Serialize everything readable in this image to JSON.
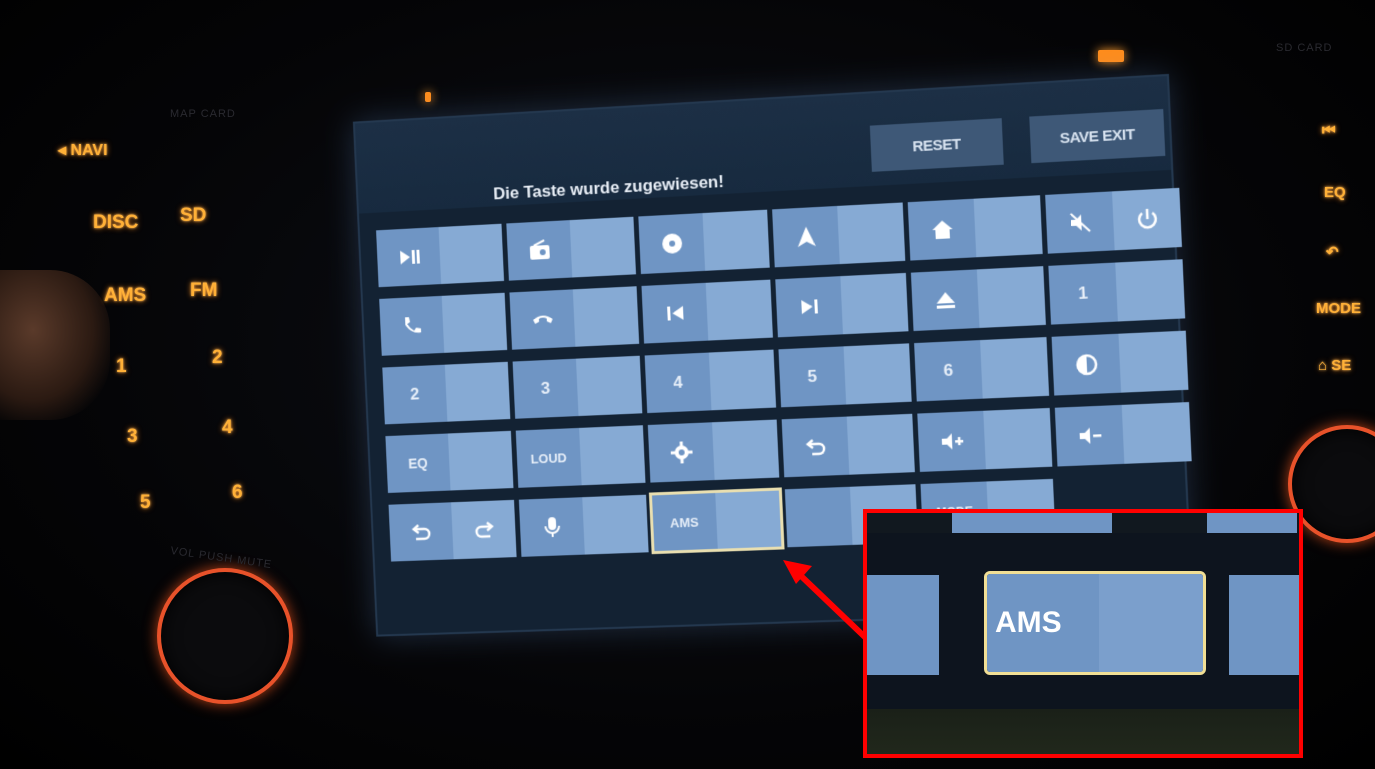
{
  "hardware": {
    "left_buttons": [
      "NAVI",
      "DISC",
      "SD",
      "AMS",
      "FM",
      "1",
      "2",
      "3",
      "4",
      "5",
      "6"
    ],
    "right_buttons": [
      "⏮",
      "EQ",
      "MODE"
    ]
  },
  "screen": {
    "status_message": "Die Taste wurde zugewiesen!",
    "reset_label": "RESET",
    "save_exit_label": "SAVE EXIT",
    "keys": {
      "num1": "1",
      "num2": "2",
      "num3": "3",
      "num4": "4",
      "num5": "5",
      "num6": "6",
      "eq": "EQ",
      "loud": "LOUD",
      "ams": "AMS",
      "mode": "MODE"
    },
    "selected_key": "AMS"
  },
  "inset": {
    "key_label": "AMS"
  },
  "colors": {
    "key_left": "#6f95c4",
    "key_right": "#86aad4",
    "selected_outline": "#f1df95",
    "hardware_glow": "#ffb037",
    "callout": "#ff0000"
  }
}
